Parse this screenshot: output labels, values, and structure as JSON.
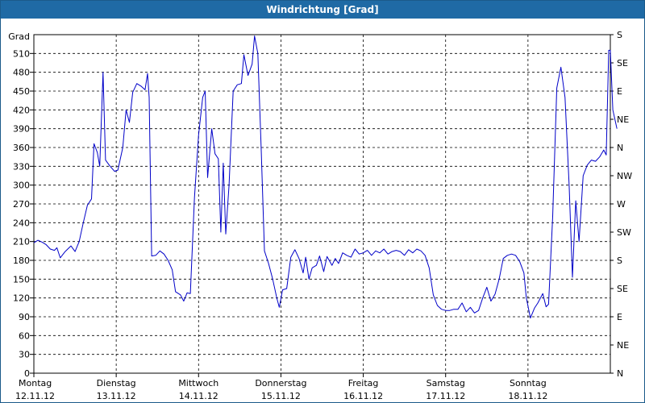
{
  "window": {
    "title": "Windrichtung [Grad]"
  },
  "chart_data": {
    "type": "line",
    "title": "Windrichtung [Grad]",
    "ylabel": "Grad",
    "ylim": [
      0,
      540
    ],
    "yticks": [
      0,
      30,
      60,
      90,
      120,
      150,
      180,
      210,
      240,
      270,
      300,
      330,
      360,
      390,
      420,
      450,
      480,
      510
    ],
    "right_axis_labels": [
      "N",
      "NE",
      "E",
      "SE",
      "S",
      "SW",
      "W",
      "NW",
      "N",
      "NE",
      "E",
      "SE",
      "S"
    ],
    "x_categories": [
      {
        "day": "Montag",
        "date": "12.11.12"
      },
      {
        "day": "Dienstag",
        "date": "13.11.12"
      },
      {
        "day": "Mittwoch",
        "date": "14.11.12"
      },
      {
        "day": "Donnerstag",
        "date": "15.11.12"
      },
      {
        "day": "Freitag",
        "date": "16.11.12"
      },
      {
        "day": "Samstag",
        "date": "17.11.12"
      },
      {
        "day": "Sonntag",
        "date": "18.11.12"
      }
    ],
    "xlim": [
      0,
      7
    ],
    "grid": true,
    "series": [
      {
        "color": "#0000c8",
        "points": [
          [
            0.0,
            208
          ],
          [
            0.05,
            212
          ],
          [
            0.1,
            209
          ],
          [
            0.15,
            205
          ],
          [
            0.2,
            198
          ],
          [
            0.25,
            196
          ],
          [
            0.28,
            200
          ],
          [
            0.32,
            184
          ],
          [
            0.38,
            194
          ],
          [
            0.45,
            203
          ],
          [
            0.5,
            194
          ],
          [
            0.55,
            210
          ],
          [
            0.6,
            240
          ],
          [
            0.65,
            268
          ],
          [
            0.7,
            278
          ],
          [
            0.73,
            366
          ],
          [
            0.77,
            352
          ],
          [
            0.8,
            330
          ],
          [
            0.84,
            480
          ],
          [
            0.87,
            340
          ],
          [
            0.92,
            331
          ],
          [
            0.98,
            322
          ],
          [
            1.02,
            324
          ],
          [
            1.08,
            360
          ],
          [
            1.12,
            420
          ],
          [
            1.16,
            400
          ],
          [
            1.2,
            448
          ],
          [
            1.25,
            462
          ],
          [
            1.3,
            458
          ],
          [
            1.35,
            452
          ],
          [
            1.38,
            478
          ],
          [
            1.4,
            440
          ],
          [
            1.43,
            187
          ],
          [
            1.48,
            188
          ],
          [
            1.53,
            195
          ],
          [
            1.58,
            190
          ],
          [
            1.63,
            180
          ],
          [
            1.68,
            165
          ],
          [
            1.72,
            130
          ],
          [
            1.78,
            125
          ],
          [
            1.82,
            115
          ],
          [
            1.86,
            128
          ],
          [
            1.9,
            127
          ],
          [
            1.95,
            280
          ],
          [
            2.0,
            380
          ],
          [
            2.05,
            440
          ],
          [
            2.08,
            450
          ],
          [
            2.11,
            312
          ],
          [
            2.16,
            390
          ],
          [
            2.2,
            350
          ],
          [
            2.24,
            342
          ],
          [
            2.27,
            225
          ],
          [
            2.3,
            335
          ],
          [
            2.33,
            222
          ],
          [
            2.37,
            300
          ],
          [
            2.42,
            450
          ],
          [
            2.47,
            460
          ],
          [
            2.52,
            462
          ],
          [
            2.55,
            508
          ],
          [
            2.6,
            475
          ],
          [
            2.65,
            493
          ],
          [
            2.68,
            538
          ],
          [
            2.72,
            510
          ],
          [
            2.76,
            360
          ],
          [
            2.8,
            195
          ],
          [
            2.85,
            175
          ],
          [
            2.9,
            150
          ],
          [
            2.95,
            120
          ],
          [
            2.98,
            105
          ],
          [
            3.02,
            133
          ],
          [
            3.07,
            135
          ],
          [
            3.12,
            185
          ],
          [
            3.17,
            197
          ],
          [
            3.22,
            183
          ],
          [
            3.27,
            160
          ],
          [
            3.3,
            185
          ],
          [
            3.34,
            150
          ],
          [
            3.38,
            168
          ],
          [
            3.43,
            172
          ],
          [
            3.47,
            187
          ],
          [
            3.52,
            162
          ],
          [
            3.56,
            186
          ],
          [
            3.62,
            172
          ],
          [
            3.66,
            183
          ],
          [
            3.7,
            175
          ],
          [
            3.75,
            192
          ],
          [
            3.8,
            188
          ],
          [
            3.85,
            185
          ],
          [
            3.9,
            198
          ],
          [
            3.95,
            190
          ],
          [
            4.0,
            192
          ],
          [
            4.05,
            196
          ],
          [
            4.1,
            188
          ],
          [
            4.15,
            195
          ],
          [
            4.2,
            192
          ],
          [
            4.25,
            198
          ],
          [
            4.3,
            190
          ],
          [
            4.35,
            194
          ],
          [
            4.4,
            196
          ],
          [
            4.45,
            194
          ],
          [
            4.5,
            188
          ],
          [
            4.55,
            197
          ],
          [
            4.6,
            192
          ],
          [
            4.65,
            198
          ],
          [
            4.7,
            195
          ],
          [
            4.75,
            188
          ],
          [
            4.8,
            168
          ],
          [
            4.85,
            125
          ],
          [
            4.9,
            108
          ],
          [
            4.95,
            102
          ],
          [
            5.0,
            100
          ],
          [
            5.05,
            100
          ],
          [
            5.1,
            102
          ],
          [
            5.15,
            102
          ],
          [
            5.2,
            112
          ],
          [
            5.25,
            98
          ],
          [
            5.3,
            105
          ],
          [
            5.35,
            96
          ],
          [
            5.4,
            100
          ],
          [
            5.45,
            120
          ],
          [
            5.5,
            137
          ],
          [
            5.55,
            115
          ],
          [
            5.6,
            126
          ],
          [
            5.65,
            150
          ],
          [
            5.7,
            183
          ],
          [
            5.75,
            188
          ],
          [
            5.8,
            190
          ],
          [
            5.85,
            188
          ],
          [
            5.9,
            178
          ],
          [
            5.95,
            160
          ],
          [
            5.98,
            120
          ],
          [
            6.03,
            88
          ],
          [
            6.08,
            104
          ],
          [
            6.12,
            112
          ],
          [
            6.18,
            127
          ],
          [
            6.22,
            106
          ],
          [
            6.25,
            110
          ],
          [
            6.3,
            250
          ],
          [
            6.35,
            455
          ],
          [
            6.4,
            488
          ],
          [
            6.45,
            440
          ],
          [
            6.5,
            300
          ],
          [
            6.54,
            153
          ],
          [
            6.58,
            275
          ],
          [
            6.62,
            210
          ],
          [
            6.67,
            315
          ],
          [
            6.72,
            332
          ],
          [
            6.77,
            340
          ],
          [
            6.82,
            338
          ],
          [
            6.87,
            345
          ],
          [
            6.92,
            356
          ],
          [
            6.95,
            348
          ],
          [
            6.98,
            515
          ],
          [
            7.0,
            515
          ],
          [
            7.03,
            420
          ],
          [
            7.08,
            390
          ]
        ]
      }
    ]
  }
}
